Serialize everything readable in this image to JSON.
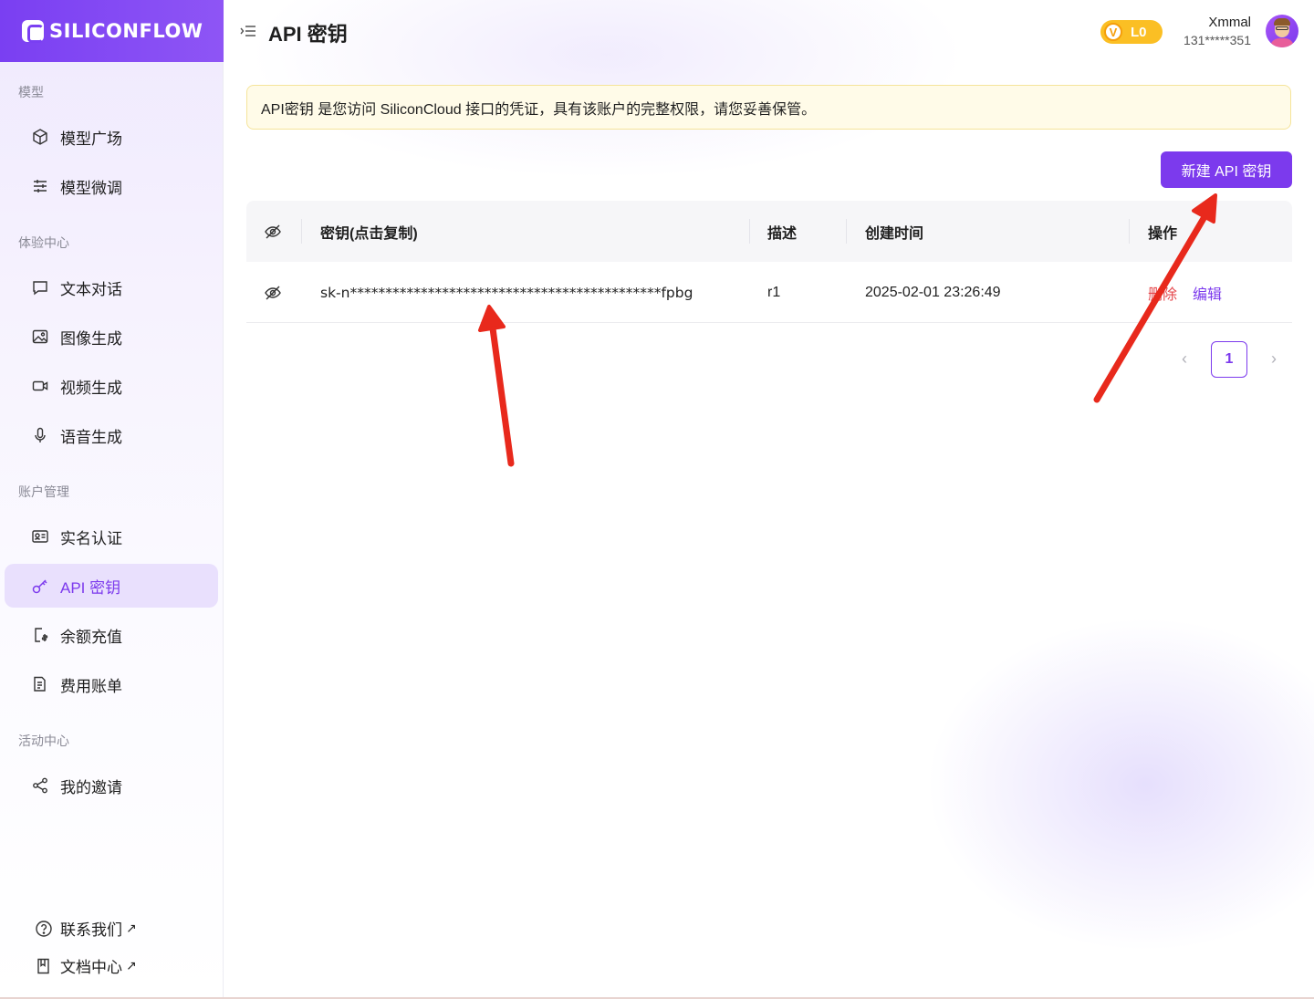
{
  "brand": {
    "name": "SILICONFLOW",
    "color": "#7c3aed"
  },
  "sidebar": {
    "sections": [
      {
        "title": "模型",
        "items": [
          {
            "label": "模型广场",
            "icon": "cube-icon"
          },
          {
            "label": "模型微调",
            "icon": "sliders-icon"
          }
        ]
      },
      {
        "title": "体验中心",
        "items": [
          {
            "label": "文本对话",
            "icon": "chat-icon"
          },
          {
            "label": "图像生成",
            "icon": "image-icon"
          },
          {
            "label": "视频生成",
            "icon": "video-icon"
          },
          {
            "label": "语音生成",
            "icon": "microphone-icon"
          }
        ]
      },
      {
        "title": "账户管理",
        "items": [
          {
            "label": "实名认证",
            "icon": "id-card-icon"
          },
          {
            "label": "API 密钥",
            "icon": "key-icon",
            "active": true
          },
          {
            "label": "余额充值",
            "icon": "wallet-icon"
          },
          {
            "label": "费用账单",
            "icon": "bill-icon"
          }
        ]
      },
      {
        "title": "活动中心",
        "items": [
          {
            "label": "我的邀请",
            "icon": "share-icon"
          }
        ]
      }
    ],
    "footer": [
      {
        "label": "联系我们",
        "icon": "help-icon",
        "ext": "↗"
      },
      {
        "label": "文档中心",
        "icon": "book-icon",
        "ext": "↗"
      }
    ]
  },
  "header": {
    "title": "API 密钥",
    "level_badge": {
      "icon_letter": "V",
      "level": "L0"
    },
    "user": {
      "name": "Xmmal",
      "phone": "131*****351"
    }
  },
  "notice": "API密钥 是您访问 SiliconCloud 接口的凭证，具有该账户的完整权限，请您妥善保管。",
  "new_key_button": "新建 API 密钥",
  "table": {
    "columns": [
      "密钥(点击复制)",
      "描述",
      "创建时间",
      "操作"
    ],
    "rows": [
      {
        "key": "sk-n********************************************fpbg",
        "description": "r1",
        "created_at": "2025-02-01 23:26:49",
        "actions": [
          "删除",
          "编辑"
        ]
      }
    ]
  },
  "pagination": {
    "current": "1",
    "prev": "‹",
    "next": "›"
  },
  "colors": {
    "accent": "#7c3aed",
    "danger": "#e5484d",
    "annotation_arrow": "#e8291c",
    "notice_bg": "#fffbe8"
  }
}
